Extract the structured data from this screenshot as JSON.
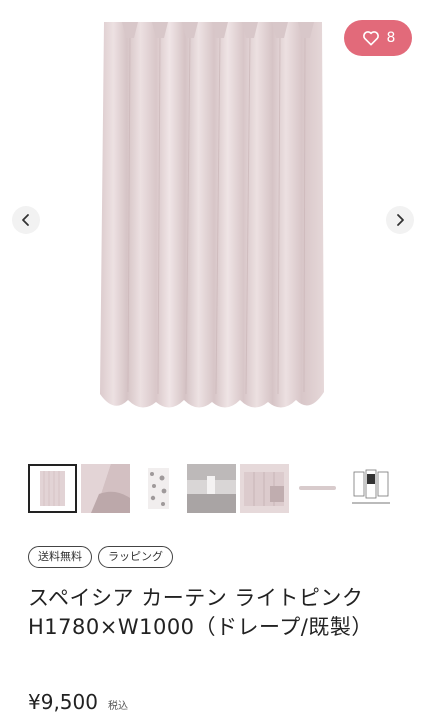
{
  "gallery": {
    "favorite_count": "8",
    "thumbnails": [
      {
        "id": "thumb-1"
      },
      {
        "id": "thumb-2"
      },
      {
        "id": "thumb-3"
      },
      {
        "id": "thumb-4"
      },
      {
        "id": "thumb-5"
      },
      {
        "id": "thumb-6"
      },
      {
        "id": "thumb-7"
      }
    ]
  },
  "tags": [
    "送料無料",
    "ラッピング"
  ],
  "product": {
    "title": "スペイシア カーテン ライトピンク H1780×W1000（ドレープ/既製）",
    "price": "¥9,500",
    "tax_note": "税込"
  },
  "colors": {
    "accent": "#e26a7a",
    "curtain": "#e2d3d5"
  },
  "icons": {
    "favorite": "heart-icon",
    "prev": "chevron-left-icon",
    "next": "chevron-right-icon"
  }
}
